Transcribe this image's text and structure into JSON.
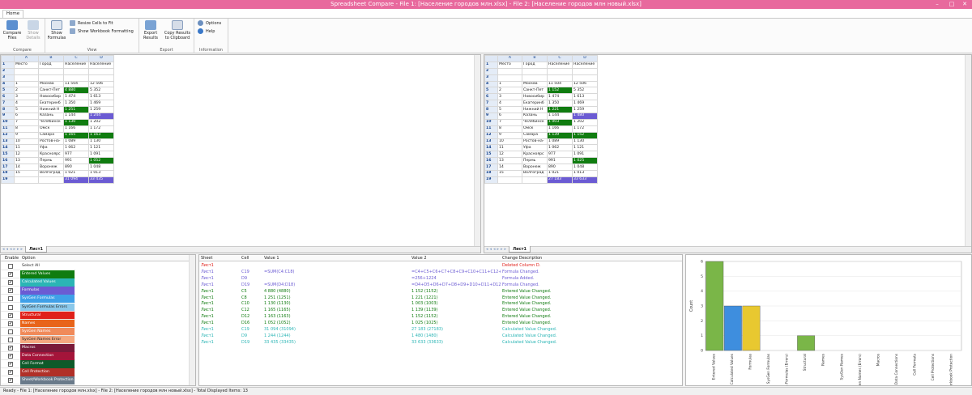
{
  "window": {
    "title": "Spreadsheet Compare - File 1: [Население городов млн.xlsx] - File 2: [Население городов млн новый.xlsx]",
    "min": "–",
    "max": "□",
    "close": "✕"
  },
  "ribbon": {
    "tab": "Home",
    "compare": {
      "btn1": "Compare Files",
      "btn2": "Show Details",
      "caption": "Compare"
    },
    "view": {
      "show_formulas": "Show Formulas",
      "resize": "Resize Cells to Fit",
      "show_formatting": "Show Workbook Formatting",
      "caption": "View"
    },
    "export": {
      "export_results": "Export Results",
      "copy": "Copy Results to Clipboard",
      "caption": "Export"
    },
    "info": {
      "options": "Options",
      "help": "Help",
      "caption": "Information"
    }
  },
  "colors": {
    "green": "#107c10",
    "purple": "#6b5bd3"
  },
  "left_sheet": {
    "cols": [
      "A",
      "B",
      "C",
      "D"
    ],
    "tab": "Лист1",
    "rows": [
      [
        "1",
        "Место",
        "Город",
        "Население",
        "Население"
      ],
      [
        "2",
        "",
        "",
        "",
        ""
      ],
      [
        "3",
        "",
        "",
        "",
        ""
      ],
      [
        "4",
        "1",
        "Москва",
        "11 504",
        "12 506"
      ],
      [
        "5",
        "2",
        "Санкт-Пет",
        "4 880",
        "5 352"
      ],
      [
        "6",
        "3",
        "Новосибир",
        "1 474",
        "1 613"
      ],
      [
        "7",
        "4",
        "Екатеринб",
        "1 350",
        "1 469"
      ],
      [
        "8",
        "5",
        "Нижний Н",
        "1 251",
        "1 259"
      ],
      [
        "9",
        "6",
        "Казань",
        "1 144",
        "1 244"
      ],
      [
        "10",
        "7",
        "Челябинск",
        "1 130",
        "1 202"
      ],
      [
        "11",
        "8",
        "Омск",
        "1 166",
        "1 172"
      ],
      [
        "12",
        "9",
        "Самара",
        "1 165",
        "1 163"
      ],
      [
        "13",
        "10",
        "Ростов-на-",
        "1 089",
        "1 130"
      ],
      [
        "14",
        "11",
        "Уфа",
        "1 062",
        "1 121"
      ],
      [
        "15",
        "12",
        "Красноярс",
        "977",
        "1 091"
      ],
      [
        "16",
        "13",
        "Пермь",
        "991",
        "1 052"
      ],
      [
        "17",
        "14",
        "Воронеж",
        "890",
        "1 048"
      ],
      [
        "18",
        "15",
        "Волгоград",
        "1 021",
        "1 013"
      ],
      [
        "19",
        "",
        "",
        "31 094",
        "33 435"
      ]
    ],
    "hl": {
      "5-3": "g",
      "8-3": "g",
      "9-4": "p",
      "10-3": "g",
      "12-3": "g",
      "12-4": "g",
      "16-4": "g",
      "19-3": "p",
      "19-4": "p"
    }
  },
  "right_sheet": {
    "cols": [
      "A",
      "B",
      "C",
      "D"
    ],
    "tab": "Лист1",
    "rows": [
      [
        "1",
        "Место",
        "Город",
        "Население",
        "Население"
      ],
      [
        "2",
        "",
        "",
        "",
        ""
      ],
      [
        "3",
        "",
        "",
        "",
        ""
      ],
      [
        "4",
        "1",
        "Москва",
        "11 504",
        "12 506"
      ],
      [
        "5",
        "2",
        "Санкт-Пет",
        "1 152",
        "5 352"
      ],
      [
        "6",
        "3",
        "Новосибир",
        "1 474",
        "1 613"
      ],
      [
        "7",
        "4",
        "Екатеринб",
        "1 350",
        "1 469"
      ],
      [
        "8",
        "5",
        "Нижний Н",
        "1 221",
        "1 259"
      ],
      [
        "9",
        "6",
        "Казань",
        "1 144",
        "1 480"
      ],
      [
        "10",
        "7",
        "Челябинск",
        "1 003",
        "1 202"
      ],
      [
        "11",
        "8",
        "Омск",
        "1 166",
        "1 172"
      ],
      [
        "12",
        "9",
        "Самара",
        "1 139",
        "1 152"
      ],
      [
        "13",
        "10",
        "Ростов-на-",
        "1 089",
        "1 130"
      ],
      [
        "14",
        "11",
        "Уфа",
        "1 062",
        "1 121"
      ],
      [
        "15",
        "12",
        "Красноярс",
        "977",
        "1 091"
      ],
      [
        "16",
        "13",
        "Пермь",
        "991",
        "1 025"
      ],
      [
        "17",
        "14",
        "Воронеж",
        "890",
        "1 048"
      ],
      [
        "18",
        "15",
        "Волгоград",
        "1 021",
        "1 013"
      ],
      [
        "19",
        "",
        "",
        "27 183",
        "33 633"
      ]
    ],
    "hl": {
      "5-3": "g",
      "8-3": "g",
      "9-4": "p",
      "10-3": "g",
      "12-3": "g",
      "12-4": "g",
      "16-4": "g",
      "19-3": "p",
      "19-4": "p"
    }
  },
  "options": {
    "header_enable": "Enable",
    "header_option": "Option",
    "items": [
      {
        "label": "Select All",
        "checked": false,
        "color": "#ffffff",
        "text": "#222"
      },
      {
        "label": "Entered Values",
        "checked": true,
        "color": "#107c10",
        "text": "#fff"
      },
      {
        "label": "Calculated Values",
        "checked": true,
        "color": "#2bb5b5",
        "text": "#fff"
      },
      {
        "label": "Formulas",
        "checked": true,
        "color": "#6b5bd3",
        "text": "#fff"
      },
      {
        "label": "SysGen Formulas",
        "checked": false,
        "color": "#3fa0e8",
        "text": "#fff"
      },
      {
        "label": "SysGen Formulas Errors",
        "checked": false,
        "color": "#8bc8ea",
        "text": "#222"
      },
      {
        "label": "Structural",
        "checked": true,
        "color": "#e0201a",
        "text": "#fff"
      },
      {
        "label": "Names",
        "checked": true,
        "color": "#e8641a",
        "text": "#fff"
      },
      {
        "label": "SysGen Names",
        "checked": false,
        "color": "#f08a5a",
        "text": "#fff"
      },
      {
        "label": "SysGen Names Error",
        "checked": false,
        "color": "#f4a880",
        "text": "#222"
      },
      {
        "label": "Macros",
        "checked": true,
        "color": "#7a1a3a",
        "text": "#fff"
      },
      {
        "label": "Data Connection",
        "checked": true,
        "color": "#a4153a",
        "text": "#fff"
      },
      {
        "label": "Cell Format",
        "checked": true,
        "color": "#0e5a2a",
        "text": "#fff"
      },
      {
        "label": "Cell Protection",
        "checked": true,
        "color": "#b03028",
        "text": "#fff"
      },
      {
        "label": "Sheet/Workbook Protection",
        "checked": true,
        "color": "#6a7a8a",
        "text": "#fff"
      }
    ]
  },
  "results": {
    "headers": [
      "Sheet",
      "Cell",
      "Value 1",
      "Value 2",
      "Change Description"
    ],
    "rows": [
      {
        "sheet": "Лист1",
        "cell": "",
        "v1": "",
        "v2": "",
        "desc": "Deleted Column D.",
        "color": "#e0201a"
      },
      {
        "sheet": "Лист1",
        "cell": "C19",
        "v1": "=SUM(C4:C18)",
        "v2": "=C4+C5+C6+C7+C8+C9+C10+C11+C12+C13+...",
        "desc": "Formula Changed.",
        "color": "#6b5bd3"
      },
      {
        "sheet": "Лист1",
        "cell": "D9",
        "v1": "",
        "v2": "=256+1224",
        "desc": "Formula Added.",
        "color": "#6b5bd3"
      },
      {
        "sheet": "Лист1",
        "cell": "D19",
        "v1": "=SUM(D4:D18)",
        "v2": "=D4+D5+D6+D7+D8+D9+D10+D11+D12+D1...",
        "desc": "Formula Changed.",
        "color": "#6b5bd3"
      },
      {
        "sheet": "Лист1",
        "cell": "C5",
        "v1": "4 880 (4880)",
        "v2": "1 152 (1152)",
        "desc": "Entered Value Changed.",
        "color": "#107c10"
      },
      {
        "sheet": "Лист1",
        "cell": "C8",
        "v1": "1 251 (1251)",
        "v2": "1 221 (1221)",
        "desc": "Entered Value Changed.",
        "color": "#107c10"
      },
      {
        "sheet": "Лист1",
        "cell": "C10",
        "v1": "1 130 (1130)",
        "v2": "1 003 (1003)",
        "desc": "Entered Value Changed.",
        "color": "#107c10"
      },
      {
        "sheet": "Лист1",
        "cell": "C12",
        "v1": "1 165 (1165)",
        "v2": "1 139 (1139)",
        "desc": "Entered Value Changed.",
        "color": "#107c10"
      },
      {
        "sheet": "Лист1",
        "cell": "D12",
        "v1": "1 163 (1163)",
        "v2": "1 152 (1152)",
        "desc": "Entered Value Changed.",
        "color": "#107c10"
      },
      {
        "sheet": "Лист1",
        "cell": "D16",
        "v1": "1 052 (1052)",
        "v2": "1 025 (1025)",
        "desc": "Entered Value Changed.",
        "color": "#107c10"
      },
      {
        "sheet": "Лист1",
        "cell": "C19",
        "v1": "31 094 (31094)",
        "v2": "27 183 (27183)",
        "desc": "Calculated Value Changed.",
        "color": "#2bb5b5"
      },
      {
        "sheet": "Лист1",
        "cell": "D9",
        "v1": "1 244 (1244)",
        "v2": "1 480 (1480)",
        "desc": "Calculated Value Changed.",
        "color": "#2bb5b5"
      },
      {
        "sheet": "Лист1",
        "cell": "D19",
        "v1": "33 435 (33435)",
        "v2": "33 633 (33633)",
        "desc": "Calculated Value Changed.",
        "color": "#2bb5b5"
      }
    ]
  },
  "chart_data": {
    "type": "bar",
    "ylabel": "Count",
    "ylim": [
      0,
      6
    ],
    "yticks": [
      "0",
      "1",
      "2",
      "3",
      "4",
      "5",
      "6"
    ],
    "categories": [
      "Entered Values",
      "Calculated Values",
      "Formulas",
      "SysGen Formulas",
      "SysGen Formulas (Errors)",
      "Structural",
      "Names",
      "SysGen Names",
      "SysGen Names (Errors)",
      "Macros",
      "Data Connections",
      "Cell Formats",
      "Cell Protections",
      "Sheet/Workbook Protection"
    ],
    "values": [
      6,
      3,
      3,
      0,
      0,
      1,
      0,
      0,
      0,
      0,
      0,
      0,
      0,
      0
    ],
    "colors": [
      "#7ab648",
      "#3e8ede",
      "#e8c830",
      "#cccccc",
      "#cccccc",
      "#7ab648",
      "#cccccc",
      "#cccccc",
      "#cccccc",
      "#cccccc",
      "#cccccc",
      "#cccccc",
      "#cccccc",
      "#cccccc"
    ]
  },
  "status": {
    "text": "Ready - File 1: [Население городов млн.xlsx] - File 2: [Население городов млн новый.xlsx] - Total Displayed Items: 13"
  }
}
